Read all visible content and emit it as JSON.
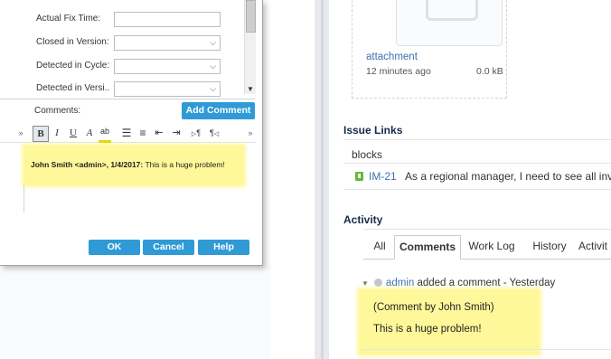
{
  "dialog": {
    "fields": [
      {
        "label": "Actual Fix Time:",
        "has_dropdown": false
      },
      {
        "label": "Closed in Version:",
        "has_dropdown": true
      },
      {
        "label": "Detected in Cycle:",
        "has_dropdown": true
      },
      {
        "label": "Detected in Versi..",
        "has_dropdown": true
      }
    ],
    "comments_label": "Comments:",
    "add_comment_button": "Add Comment",
    "toolbar": {
      "bold": "B",
      "italic": "I",
      "underline": "U",
      "font_color": "A",
      "highlight": "ab",
      "ltr": "¶",
      "rtl": "¶"
    },
    "comment_author": "John Smith <admin>, 1/4/2017:",
    "comment_text": " This is a huge problem!",
    "buttons": {
      "ok": "OK",
      "cancel": "Cancel",
      "help": "Help"
    }
  },
  "issue": {
    "attachment": {
      "name": "attachment",
      "time": "12 minutes ago",
      "size": "0.0 kB"
    },
    "issue_links": {
      "title": "Issue Links",
      "relation": "blocks",
      "link": {
        "key": "IM-21",
        "summary": "As a regional manager, I need to see all inver"
      }
    },
    "activity": {
      "title": "Activity",
      "tabs": [
        "All",
        "Comments",
        "Work Log",
        "History",
        "Activit"
      ],
      "active_tab": "Comments",
      "comment": {
        "user": "admin",
        "action": "added a comment - Yesterday",
        "line1": "(Comment by John Smith)",
        "line2": "This is a huge problem!"
      }
    }
  },
  "colors": {
    "accent": "#2f9ad6",
    "link": "#3b73af",
    "highlight": "#fff89a",
    "story_green": "#63ba3c"
  }
}
